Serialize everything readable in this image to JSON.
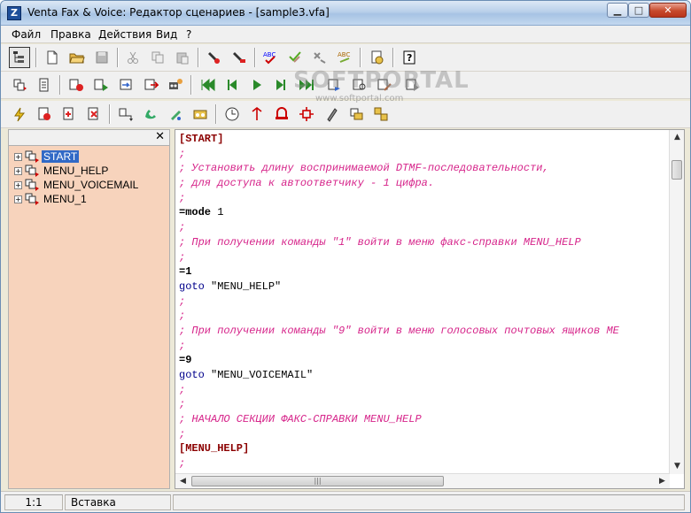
{
  "window": {
    "title": "Venta Fax & Voice: Редактор сценариев - [sample3.vfa]",
    "controls": {
      "minimize": "▁",
      "maximize": "□",
      "close": "✕"
    }
  },
  "menu": [
    "Файл",
    "Правка",
    "Действия",
    "Вид",
    "?"
  ],
  "watermark": {
    "text": "SOFTPORTAL",
    "url": "www.softportal.com"
  },
  "left_panel": {
    "close_glyph": "✕",
    "tree": [
      {
        "label": "START",
        "selected": true
      },
      {
        "label": "MENU_HELP",
        "selected": false
      },
      {
        "label": "MENU_VOICEMAIL",
        "selected": false
      },
      {
        "label": "MENU_1",
        "selected": false
      }
    ]
  },
  "editor": {
    "lines": [
      {
        "type": "section",
        "text": "[START]"
      },
      {
        "type": "comment",
        "text": ";"
      },
      {
        "type": "comment",
        "text": "; Установить длину воспринимаемой DTMF-последовательности,"
      },
      {
        "type": "comment",
        "text": "; для доступа к автоответчику - 1 цифра."
      },
      {
        "type": "comment",
        "text": ";"
      },
      {
        "type": "cmd_mode",
        "text": "=mode",
        "arg": " 1"
      },
      {
        "type": "comment",
        "text": ";"
      },
      {
        "type": "comment",
        "text": "; При получении команды \"1\" войти в меню факс-справки MENU_HELP"
      },
      {
        "type": "comment",
        "text": ";"
      },
      {
        "type": "cmdb",
        "text": "=1"
      },
      {
        "type": "goto",
        "text": "goto",
        "arg": " \"MENU_HELP\""
      },
      {
        "type": "comment",
        "text": ";"
      },
      {
        "type": "comment",
        "text": ";"
      },
      {
        "type": "comment",
        "text": "; При получении команды \"9\" войти в меню голосовых почтовых ящиков МЕ"
      },
      {
        "type": "comment",
        "text": ";"
      },
      {
        "type": "cmdb",
        "text": "=9"
      },
      {
        "type": "goto",
        "text": "goto",
        "arg": " \"MENU_VOICEMAIL\""
      },
      {
        "type": "comment",
        "text": ";"
      },
      {
        "type": "comment",
        "text": ";"
      },
      {
        "type": "comment",
        "text": "; НАЧАЛО СЕКЦИИ ФАКС-СПРАВКИ MENU_HELP"
      },
      {
        "type": "comment",
        "text": ";"
      },
      {
        "type": "section",
        "text": "[MENU_HELP]"
      },
      {
        "type": "comment",
        "text": ";"
      }
    ]
  },
  "status": {
    "position": "1:1",
    "mode": "Вставка",
    "extra": ""
  }
}
